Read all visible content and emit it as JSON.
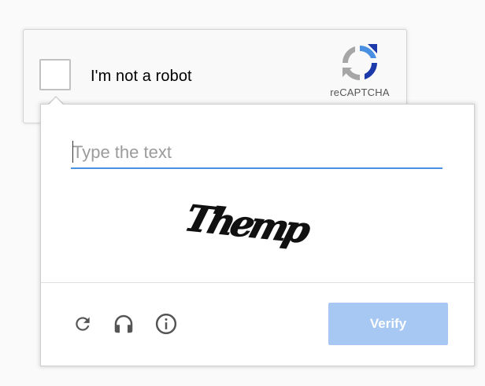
{
  "widget": {
    "checkbox_label": "I'm not a robot",
    "logo_text": "reCAPTCHA",
    "logo_icon": "recaptcha-logo-icon"
  },
  "challenge": {
    "input_placeholder": "Type the text",
    "input_value": "",
    "captcha_text": "Themp",
    "verify_label": "Verify",
    "tools": [
      {
        "name": "refresh",
        "icon": "refresh-icon"
      },
      {
        "name": "audio",
        "icon": "headphones-icon"
      },
      {
        "name": "info",
        "icon": "info-icon"
      }
    ]
  },
  "colors": {
    "accent_blue": "#4a90e2",
    "verify_disabled": "#a6c8f2",
    "logo_blue": "#1c3aa9",
    "logo_light_blue": "#4a90e2",
    "logo_gray": "#a6a6a6",
    "icon_gray": "#555555"
  }
}
